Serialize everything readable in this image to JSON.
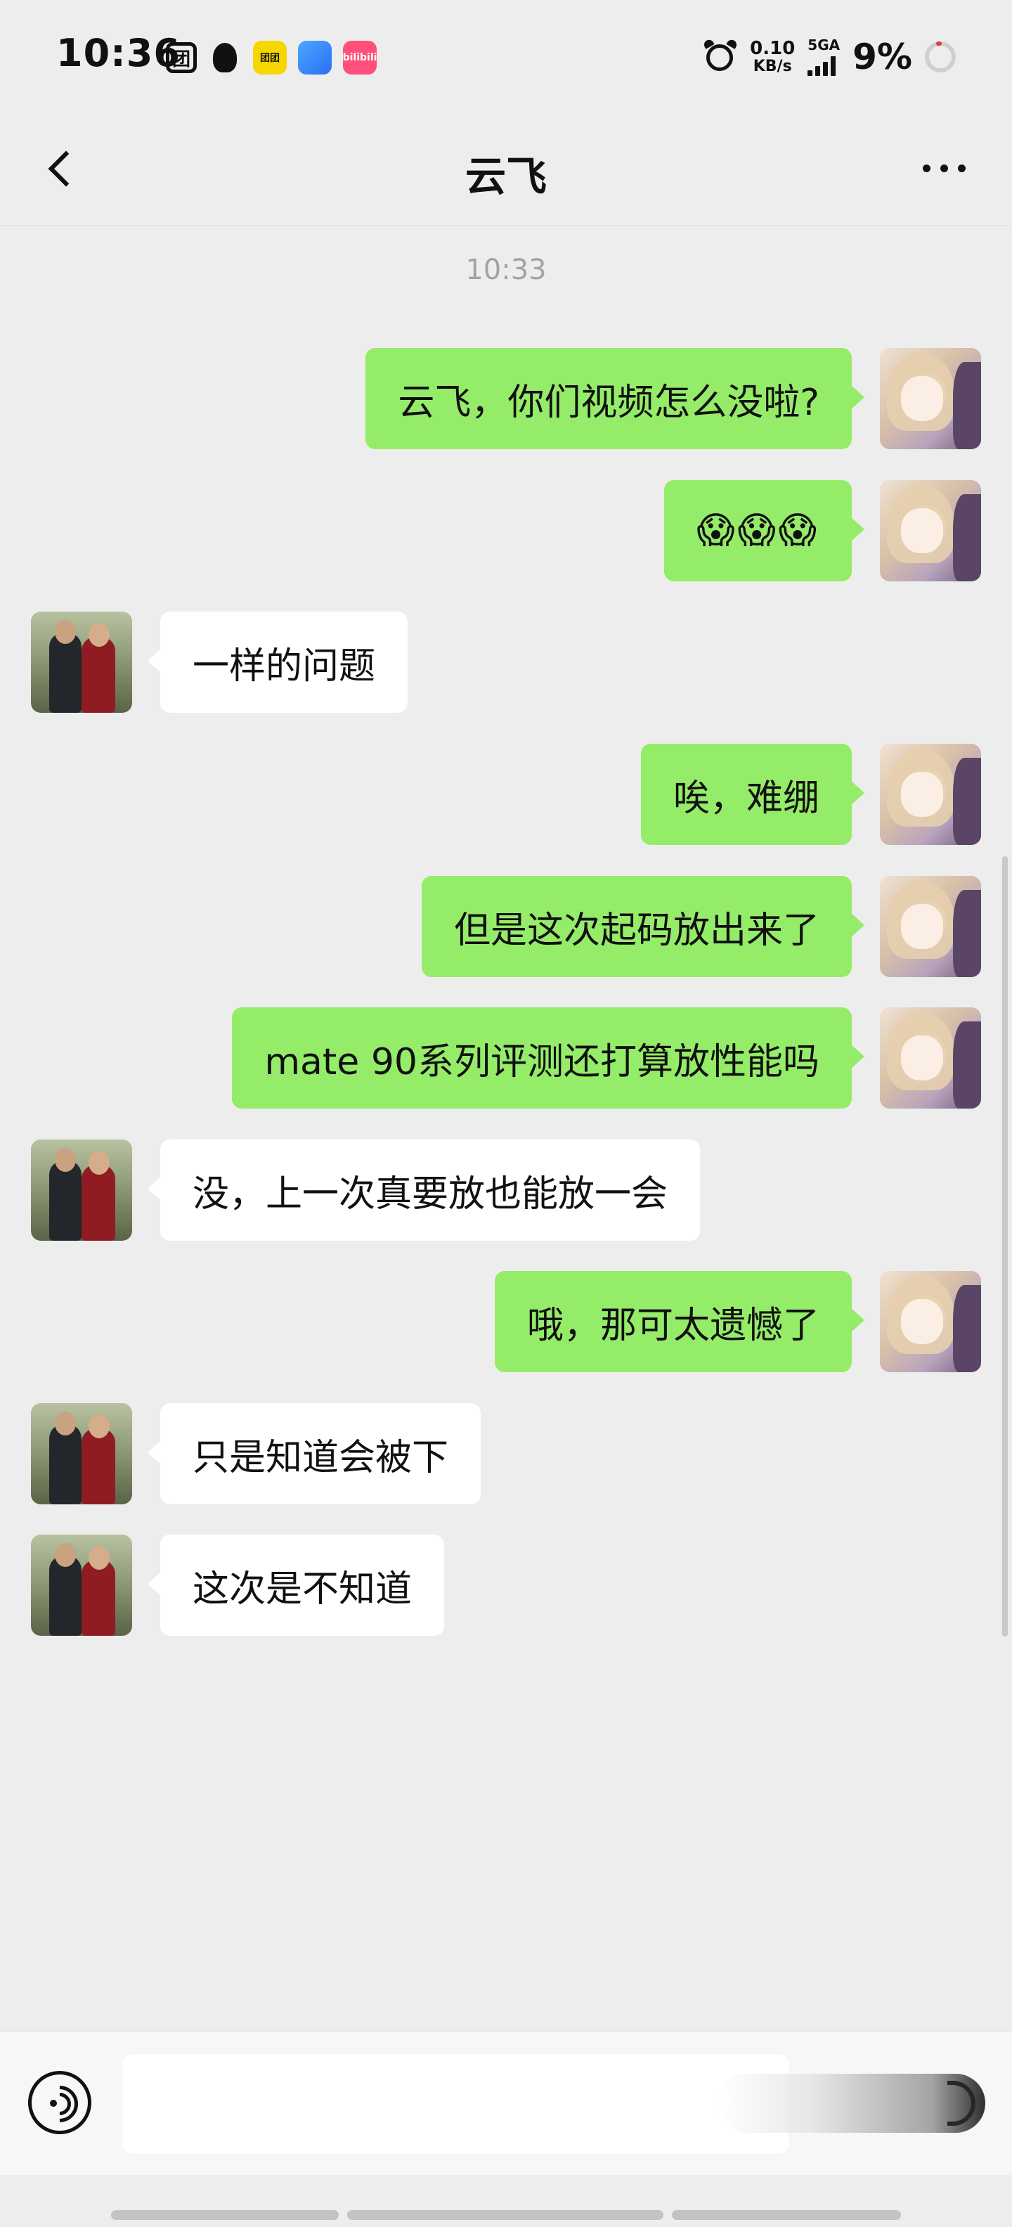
{
  "status_bar": {
    "time": "10:36",
    "notification_icons": [
      "团",
      "qq-icon",
      "团团",
      "app-icon",
      "bilibili"
    ],
    "net_speed_value": "0.10",
    "net_speed_unit": "KB/s",
    "network_type": "5GA",
    "battery_percent": "9%"
  },
  "header": {
    "back_label": "back",
    "title": "云飞",
    "more_label": "more"
  },
  "chat": {
    "timestamp": "10:33",
    "messages": [
      {
        "sender": "me",
        "text": "云飞，你们视频怎么没啦?"
      },
      {
        "sender": "me",
        "text": "😱😱😱"
      },
      {
        "sender": "friend",
        "text": "一样的问题"
      },
      {
        "sender": "me",
        "text": "唉，难绷"
      },
      {
        "sender": "me",
        "text": "但是这次起码放出来了"
      },
      {
        "sender": "me",
        "text": "mate 90系列评测还打算放性能吗"
      },
      {
        "sender": "friend",
        "text": "没，上一次真要放也能放一会"
      },
      {
        "sender": "me",
        "text": "哦，那可太遗憾了"
      },
      {
        "sender": "friend",
        "text": "只是知道会被下"
      },
      {
        "sender": "friend",
        "text": "这次是不知道"
      }
    ]
  },
  "input_bar": {
    "message_value": ""
  },
  "colors": {
    "background": "#ededed",
    "my_bubble": "#95ec69",
    "friend_bubble": "#ffffff"
  }
}
